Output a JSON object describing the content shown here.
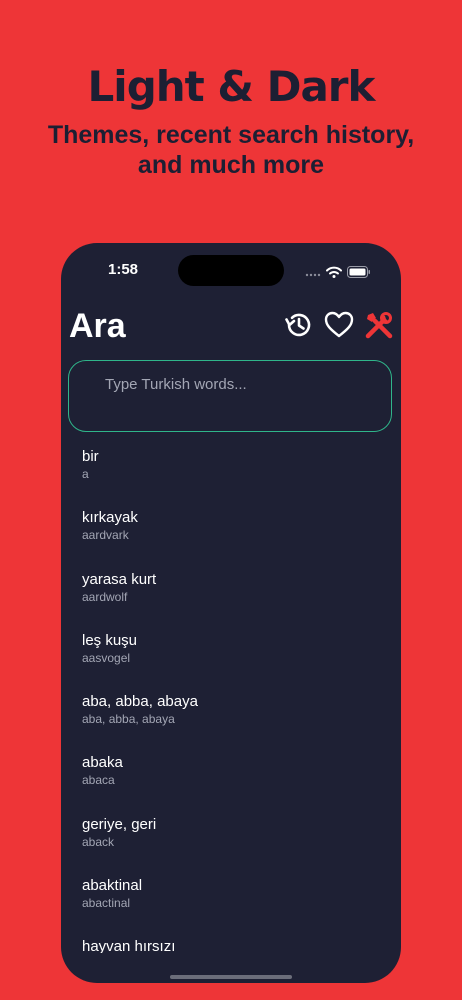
{
  "promo": {
    "title": "Light & Dark",
    "subtitle": "Themes, recent search history, and much more"
  },
  "status_bar": {
    "time": "1:58"
  },
  "header": {
    "title": "Ara",
    "icons": [
      "history-icon",
      "heart-icon",
      "tools-icon"
    ]
  },
  "search": {
    "placeholder": "Type Turkish words..."
  },
  "words": [
    {
      "tr": "bir",
      "en": "a"
    },
    {
      "tr": "kırkayak",
      "en": "aardvark"
    },
    {
      "tr": "yarasa kurt",
      "en": "aardwolf"
    },
    {
      "tr": "leş kuşu",
      "en": "aasvogel"
    },
    {
      "tr": "aba, abba, abaya",
      "en": "aba, abba, abaya"
    },
    {
      "tr": "abaka",
      "en": "abaca"
    },
    {
      "tr": "geriye, geri",
      "en": "aback"
    },
    {
      "tr": "abaktinal",
      "en": "abactinal"
    },
    {
      "tr": "hayvan hırsızı",
      "en": ""
    }
  ],
  "colors": {
    "background": "#ee3537",
    "screen": "#1e2034",
    "accent_border": "#2fb58a",
    "tools_icon": "#ee3537",
    "text_primary": "#ffffff",
    "text_secondary": "#a3a6b4"
  }
}
